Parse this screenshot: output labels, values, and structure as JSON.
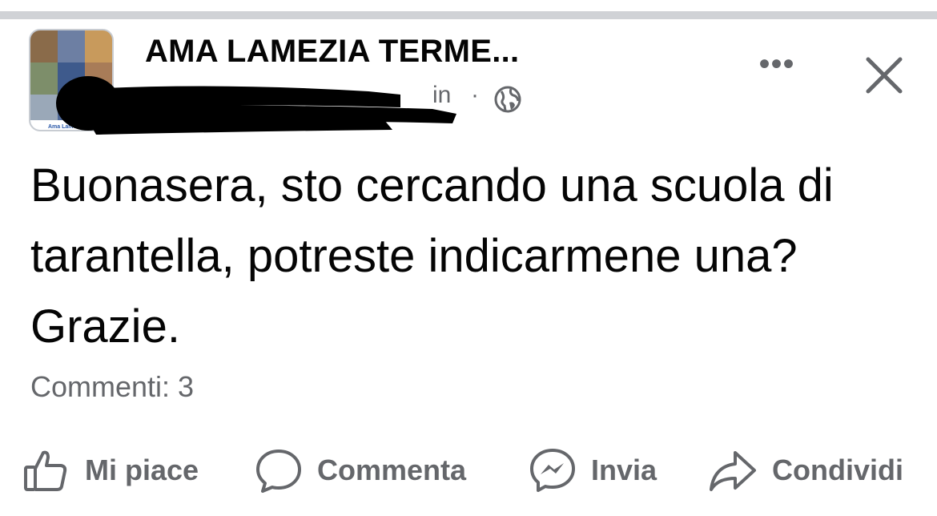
{
  "post": {
    "author": "AMA LAMEZIA TERME...",
    "time_suffix": "in",
    "meta_separator": "·",
    "body": "Buonasera, sto cercando una scuola di tarantella, potreste indicarmene una? Grazie.",
    "comments_label": "Commenti: 3"
  },
  "header": {
    "more_label": "•••",
    "avatar_caption": "Ama Lame"
  },
  "actions": {
    "like": "Mi piace",
    "comment": "Commenta",
    "send": "Invia",
    "share": "Condividi"
  },
  "icons": {
    "globe": "globe-icon",
    "close": "close-icon",
    "more": "more-icon",
    "like": "thumbs-up-icon",
    "comment": "comment-bubble-icon",
    "send": "messenger-icon",
    "share": "share-arrow-icon"
  },
  "colors": {
    "secondary_text": "#65676b",
    "primary_text": "#050505",
    "divider": "#d0d2d6",
    "redaction": "#000000"
  }
}
